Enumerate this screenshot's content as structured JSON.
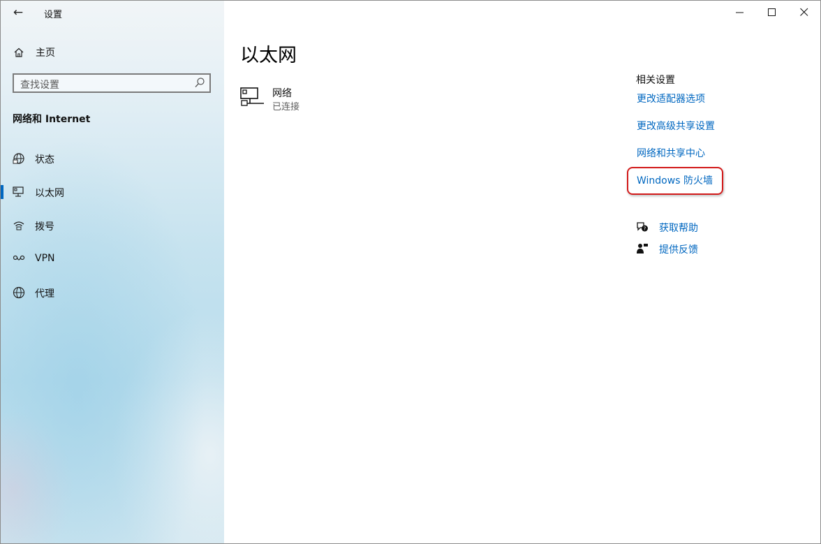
{
  "app": {
    "title": "设置",
    "back_glyph": "←"
  },
  "sidebar": {
    "home_label": "主页",
    "search_placeholder": "查找设置",
    "section_title": "网络和 Internet",
    "items": [
      {
        "label": "状态",
        "icon": "globe-status-icon",
        "selected": false
      },
      {
        "label": "以太网",
        "icon": "ethernet-icon",
        "selected": true
      },
      {
        "label": "拨号",
        "icon": "dialup-icon",
        "selected": false
      },
      {
        "label": "VPN",
        "icon": "vpn-icon",
        "selected": false
      },
      {
        "label": "代理",
        "icon": "globe-icon",
        "selected": false
      }
    ]
  },
  "main": {
    "title": "以太网",
    "network": {
      "name": "网络",
      "status": "已连接"
    },
    "related": {
      "title": "相关设置",
      "links": [
        "更改适配器选项",
        "更改高级共享设置",
        "网络和共享中心",
        "Windows 防火墙"
      ]
    },
    "help": {
      "get_help": "获取帮助",
      "feedback": "提供反馈"
    }
  },
  "colors": {
    "accent": "#0067c0",
    "highlight": "#d21a1a"
  }
}
